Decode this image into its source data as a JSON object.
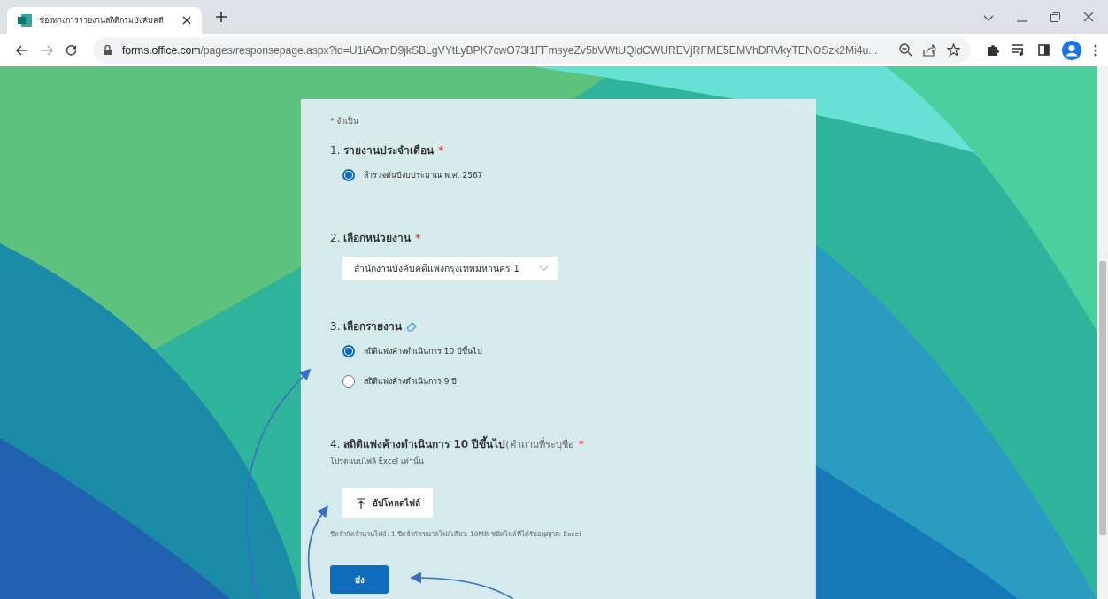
{
  "browser": {
    "tab": {
      "title": "ช่องทางการรายงานสถิติกรมบังคับคดี",
      "selected": true
    },
    "url_host": "forms.office.com",
    "url_path": "/pages/responsepage.aspx?id=U1iAOmD9jkSBLgVYtLyBPK7cwO73l1FFmsyeZv5bVWtUQldCWUREVjRFME5EMVhDRVkyTENOSzk2Mi4u..."
  },
  "form": {
    "required_note": "* จำเป็น",
    "required_marker": "*",
    "questions": [
      {
        "kind": "radio",
        "number": "1.",
        "title": "รายงานประจำเดือน",
        "required": true,
        "clearable": false,
        "options": [
          {
            "label": "สำรวจต้นปีงบประมาณ พ.ศ. 2567",
            "selected": true
          }
        ]
      },
      {
        "kind": "dropdown",
        "number": "2.",
        "title": "เลือกหน่วยงาน",
        "required": true,
        "clearable": false,
        "value": "สำนักงานบังคับคดีแพ่งกรุงเทพมหานคร 1"
      },
      {
        "kind": "radio",
        "number": "3.",
        "title": "เลือกรายงาน",
        "required": false,
        "clearable": true,
        "options": [
          {
            "label": "สถิติแพ่งค้างดำเนินการ 10 ปีขึ้นไป",
            "selected": true
          },
          {
            "label": "สถิติแพ่งค้างดำเนินการ 9 ปี",
            "selected": false
          }
        ]
      },
      {
        "kind": "upload",
        "number": "4.",
        "title": "สถิติแพ่งค้างดำเนินการ 10 ปีขึ้นไป",
        "note": "(คำถามที่ระบุชื่อ",
        "required": true,
        "clearable": false,
        "subtitle": "โปรดแนบไฟล์ Excel เท่านั้น",
        "button": "อัปโหลดไฟล์",
        "limits": "ขีดจำกัดจำนวนไฟล์: 1   ขีดจำกัดขนาดไฟล์เดียว: 10MB   ชนิดไฟล์ที่ได้รับอนุญาต: Excel"
      }
    ],
    "submit": "ส่ง"
  }
}
